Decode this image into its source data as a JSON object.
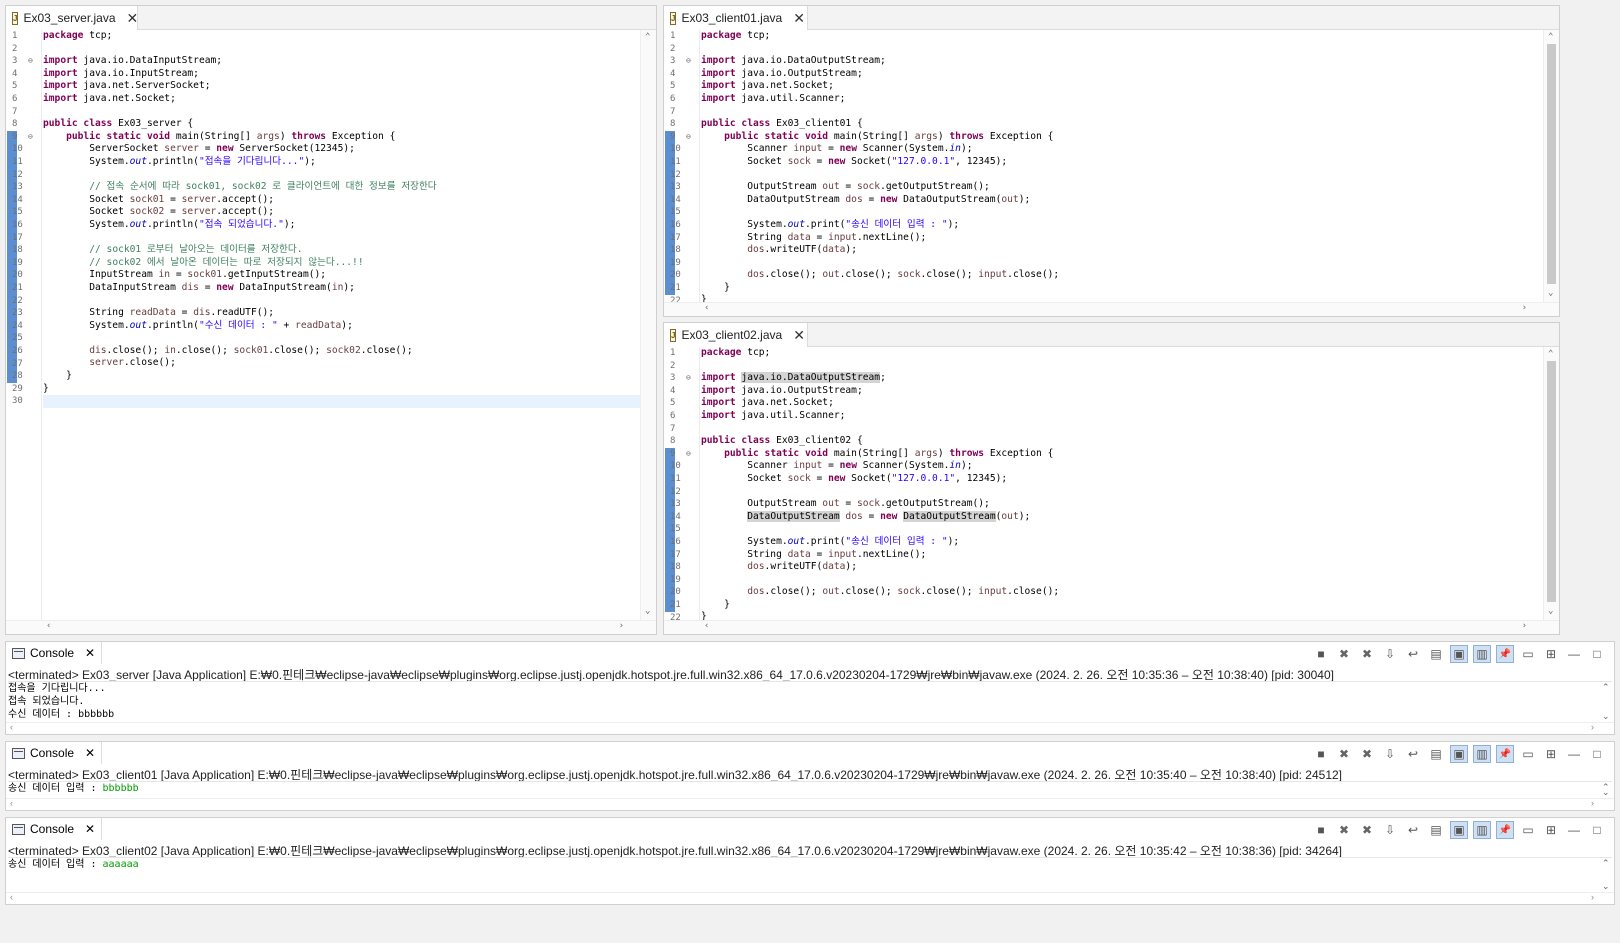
{
  "editors": {
    "server": {
      "tab_label": "Ex03_server.java",
      "lines": [
        {
          "n": "1",
          "h": "<span class=\"kw\">package</span> tcp;"
        },
        {
          "n": "2",
          "h": ""
        },
        {
          "n": "3",
          "fold": true,
          "h": "<span class=\"kw\">import</span> java.io.DataInputStream;"
        },
        {
          "n": "4",
          "h": "<span class=\"kw\">import</span> java.io.InputStream;"
        },
        {
          "n": "5",
          "h": "<span class=\"kw\">import</span> java.net.ServerSocket;"
        },
        {
          "n": "6",
          "h": "<span class=\"kw\">import</span> java.net.Socket;"
        },
        {
          "n": "7",
          "h": ""
        },
        {
          "n": "8",
          "h": "<span class=\"kw\">public class</span> Ex03_server {"
        },
        {
          "n": "9",
          "fold": true,
          "h": "    <span class=\"kw\">public static void</span> main(String[] <span class=\"var\">args</span>) <span class=\"kw\">throws</span> Exception {"
        },
        {
          "n": "10",
          "h": "        ServerSocket <span class=\"var\">server</span> = <span class=\"kw\">new</span> ServerSocket(12345);"
        },
        {
          "n": "11",
          "h": "        System.<span class=\"fld\">out</span>.println(<span class=\"str\">\"접속을 기다립니다...\"</span>);"
        },
        {
          "n": "12",
          "h": ""
        },
        {
          "n": "13",
          "h": "        <span class=\"cm\">// 접속 순서에 따라 sock01, sock02 로 클라이언트에 대한 정보를 저장한다</span>"
        },
        {
          "n": "14",
          "h": "        Socket <span class=\"var\">sock01</span> = <span class=\"var\">server</span>.accept();"
        },
        {
          "n": "15",
          "h": "        Socket <span class=\"var\">sock02</span> = <span class=\"var\">server</span>.accept();"
        },
        {
          "n": "16",
          "h": "        System.<span class=\"fld\">out</span>.println(<span class=\"str\">\"접속 되었습니다.\"</span>);"
        },
        {
          "n": "17",
          "h": ""
        },
        {
          "n": "18",
          "h": "        <span class=\"cm\">// sock01 로부터 날아오는 데이터를 저장한다.</span>"
        },
        {
          "n": "19",
          "h": "        <span class=\"cm\">// sock02 에서 날아온 데이터는 따로 저장되지 않는다...!!</span>"
        },
        {
          "n": "20",
          "h": "        InputStream <span class=\"var\">in</span> = <span class=\"var\">sock01</span>.getInputStream();"
        },
        {
          "n": "21",
          "h": "        DataInputStream <span class=\"var\">dis</span> = <span class=\"kw\">new</span> DataInputStream(<span class=\"var\">in</span>);"
        },
        {
          "n": "22",
          "h": ""
        },
        {
          "n": "23",
          "h": "        String <span class=\"var\">readData</span> = <span class=\"var\">dis</span>.readUTF();"
        },
        {
          "n": "24",
          "h": "        System.<span class=\"fld\">out</span>.println(<span class=\"str\">\"수신 데이터 : \"</span> + <span class=\"var\">readData</span>);"
        },
        {
          "n": "25",
          "h": ""
        },
        {
          "n": "26",
          "h": "        <span class=\"var\">dis</span>.close(); <span class=\"var\">in</span>.close(); <span class=\"var\">sock01</span>.close(); <span class=\"var\">sock02</span>.close();"
        },
        {
          "n": "27",
          "h": "        <span class=\"var\">server</span>.close();"
        },
        {
          "n": "28",
          "h": "    }"
        },
        {
          "n": "29",
          "h": "}"
        },
        {
          "n": "30",
          "h": "",
          "cur": true
        }
      ]
    },
    "client01": {
      "tab_label": "Ex03_client01.java",
      "lines": [
        {
          "n": "1",
          "h": "<span class=\"kw\">package</span> tcp;"
        },
        {
          "n": "2",
          "h": ""
        },
        {
          "n": "3",
          "fold": true,
          "h": "<span class=\"kw\">import</span> java.io.DataOutputStream;"
        },
        {
          "n": "4",
          "h": "<span class=\"kw\">import</span> java.io.OutputStream;"
        },
        {
          "n": "5",
          "h": "<span class=\"kw\">import</span> java.net.Socket;"
        },
        {
          "n": "6",
          "h": "<span class=\"kw\">import</span> java.util.Scanner;"
        },
        {
          "n": "7",
          "h": ""
        },
        {
          "n": "8",
          "h": "<span class=\"kw\">public class</span> Ex03_client01 {"
        },
        {
          "n": "9",
          "fold": true,
          "h": "    <span class=\"kw\">public static void</span> main(String[] <span class=\"var\">args</span>) <span class=\"kw\">throws</span> Exception {"
        },
        {
          "n": "10",
          "h": "        Scanner <span class=\"var\">input</span> = <span class=\"kw\">new</span> Scanner(System.<span class=\"fld\">in</span>);"
        },
        {
          "n": "11",
          "h": "        Socket <span class=\"var\">sock</span> = <span class=\"kw\">new</span> Socket(<span class=\"str\">\"127.0.0.1\"</span>, 12345);"
        },
        {
          "n": "12",
          "h": ""
        },
        {
          "n": "13",
          "h": "        OutputStream <span class=\"var\">out</span> = <span class=\"var\">sock</span>.getOutputStream();"
        },
        {
          "n": "14",
          "h": "        DataOutputStream <span class=\"var\">dos</span> = <span class=\"kw\">new</span> DataOutputStream(<span class=\"var\">out</span>);"
        },
        {
          "n": "15",
          "h": ""
        },
        {
          "n": "16",
          "h": "        System.<span class=\"fld\">out</span>.print(<span class=\"str\">\"송신 데이터 입력 : \"</span>);"
        },
        {
          "n": "17",
          "h": "        String <span class=\"var\">data</span> = <span class=\"var\">input</span>.nextLine();"
        },
        {
          "n": "18",
          "h": "        <span class=\"var\">dos</span>.writeUTF(<span class=\"var\">data</span>);"
        },
        {
          "n": "19",
          "h": ""
        },
        {
          "n": "20",
          "h": "        <span class=\"var\">dos</span>.close(); <span class=\"var\">out</span>.close(); <span class=\"var\">sock</span>.close(); <span class=\"var\">input</span>.close();"
        },
        {
          "n": "21",
          "h": "    }"
        },
        {
          "n": "22",
          "h": "}"
        }
      ]
    },
    "client02": {
      "tab_label": "Ex03_client02.java",
      "lines": [
        {
          "n": "1",
          "h": "<span class=\"kw\">package</span> tcp;"
        },
        {
          "n": "2",
          "h": ""
        },
        {
          "n": "3",
          "fold": true,
          "h": "<span class=\"kw\">import</span> <span class=\"hl\">java.io.DataOutputStream</span>;"
        },
        {
          "n": "4",
          "h": "<span class=\"kw\">import</span> java.io.OutputStream;"
        },
        {
          "n": "5",
          "h": "<span class=\"kw\">import</span> java.net.Socket;"
        },
        {
          "n": "6",
          "h": "<span class=\"kw\">import</span> java.util.Scanner;"
        },
        {
          "n": "7",
          "h": ""
        },
        {
          "n": "8",
          "h": "<span class=\"kw\">public class</span> Ex03_client02 {"
        },
        {
          "n": "9",
          "fold": true,
          "h": "    <span class=\"kw\">public static void</span> main(String[] <span class=\"var\">args</span>) <span class=\"kw\">throws</span> Exception {"
        },
        {
          "n": "10",
          "h": "        Scanner <span class=\"var\">input</span> = <span class=\"kw\">new</span> Scanner(System.<span class=\"fld\">in</span>);"
        },
        {
          "n": "11",
          "h": "        Socket <span class=\"var\">sock</span> = <span class=\"kw\">new</span> Socket(<span class=\"str\">\"127.0.0.1\"</span>, 12345);"
        },
        {
          "n": "12",
          "h": ""
        },
        {
          "n": "13",
          "h": "        OutputStream <span class=\"var\">out</span> = <span class=\"var\">sock</span>.getOutputStream();"
        },
        {
          "n": "14",
          "h": "        <span class=\"hl\">DataOutputStream</span> <span class=\"var\">dos</span> = <span class=\"kw\">new</span> <span class=\"hl\">DataOutputStream</span>(<span class=\"var\">out</span>);"
        },
        {
          "n": "15",
          "h": ""
        },
        {
          "n": "16",
          "h": "        System.<span class=\"fld\">out</span>.print(<span class=\"str\">\"송신 데이터 입력 : \"</span>);"
        },
        {
          "n": "17",
          "h": "        String <span class=\"var\">data</span> = <span class=\"var\">input</span>.nextLine();"
        },
        {
          "n": "18",
          "h": "        <span class=\"var\">dos</span>.writeUTF(<span class=\"var\">data</span>);"
        },
        {
          "n": "19",
          "h": ""
        },
        {
          "n": "20",
          "h": "        <span class=\"var\">dos</span>.close(); <span class=\"var\">out</span>.close(); <span class=\"var\">sock</span>.close(); <span class=\"var\">input</span>.close();"
        },
        {
          "n": "21",
          "h": "    }"
        },
        {
          "n": "22",
          "h": "}"
        }
      ]
    }
  },
  "consoles": [
    {
      "tab_label": "Console",
      "header": "<terminated> Ex03_server [Java Application] E:₩0.핀테크₩eclipse-java₩eclipse₩plugins₩org.eclipse.justj.openjdk.hotspot.jre.full.win32.x86_64_17.0.6.v20230204-1729₩jre₩bin₩javaw.exe  (2024. 2. 26. 오전 10:35:36 – 오전 10:38:40) [pid: 30040]",
      "output": [
        {
          "text": "접속을 기다립니다...",
          "input": ""
        },
        {
          "text": "접속 되었습니다.",
          "input": ""
        },
        {
          "text": "수신 데이터 : bbbbbb",
          "input": ""
        }
      ]
    },
    {
      "tab_label": "Console",
      "header": "<terminated> Ex03_client01 [Java Application] E:₩0.핀테크₩eclipse-java₩eclipse₩plugins₩org.eclipse.justj.openjdk.hotspot.jre.full.win32.x86_64_17.0.6.v20230204-1729₩jre₩bin₩javaw.exe  (2024. 2. 26. 오전 10:35:40 – 오전 10:38:40) [pid: 24512]",
      "output": [
        {
          "text": "송신 데이터 입력 : ",
          "input": "bbbbbb"
        }
      ]
    },
    {
      "tab_label": "Console",
      "header": "<terminated> Ex03_client02 [Java Application] E:₩0.핀테크₩eclipse-java₩eclipse₩plugins₩org.eclipse.justj.openjdk.hotspot.jre.full.win32.x86_64_17.0.6.v20230204-1729₩jre₩bin₩javaw.exe  (2024. 2. 26. 오전 10:35:42 – 오전 10:38:36) [pid: 34264]",
      "output": [
        {
          "text": "송신 데이터 입력 : ",
          "input": "aaaaaa"
        }
      ]
    }
  ],
  "console_toolbar": [
    "terminate-icon",
    "remove-launch-icon",
    "remove-all-icon",
    "scroll-lock-icon",
    "word-wrap-icon",
    "show-on-output-icon",
    "show-stdout-icon",
    "show-stderr-icon",
    "pin-console-icon",
    "display-console-icon",
    "open-console-icon",
    "minimize-icon",
    "maximize-icon"
  ]
}
